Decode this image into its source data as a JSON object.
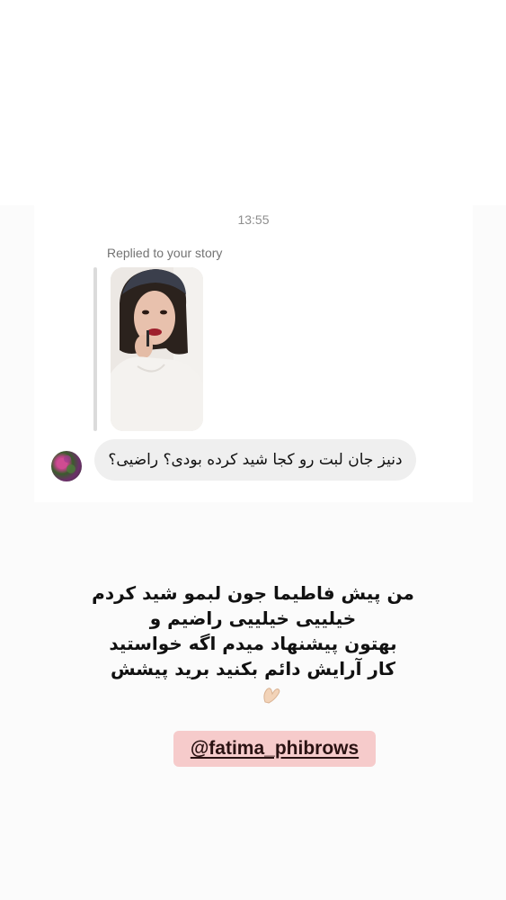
{
  "dm": {
    "time": "13:55",
    "replied_label": "Replied to your story",
    "message": "دنیز جان لبت رو کجا شید کرده بودی؟ راضیی؟",
    "story_thumbnail_icon": "story-photo-woman-applying-lipstick",
    "avatar_icon": "user-avatar"
  },
  "caption": {
    "line1": "من پیش فاطیما جون لبمو شید کردم",
    "line2": "خیلییی خیلییی راضیم و",
    "line3": "بهتون پیشنهاد میدم اگه خواستید",
    "line4": "کار آرایش دائم بکنید برید پیشش",
    "emoji_icon": "pinching-hand-emoji"
  },
  "mention": {
    "text": "@fatima_phibrows",
    "background_color": "#f6cbcb"
  }
}
